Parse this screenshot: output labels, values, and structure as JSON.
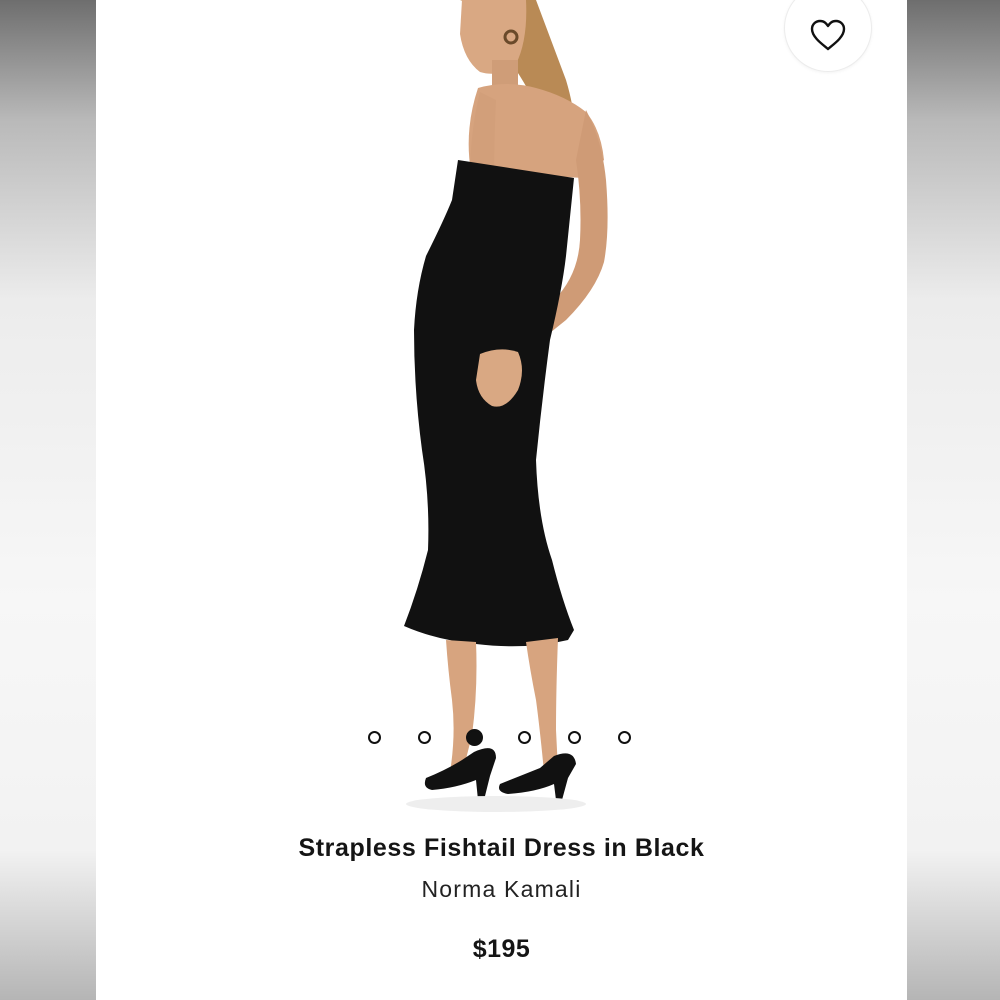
{
  "product": {
    "name": "Strapless Fishtail Dress in Black",
    "brand": "Norma Kamali",
    "price": "$195"
  },
  "favorite": {
    "icon": "heart-outline-icon"
  },
  "carousel": {
    "total": 6,
    "active_index": 2
  },
  "colors": {
    "text": "#151515",
    "dress": "#111111",
    "skin": "#d9a883",
    "hair": "#b98a55"
  }
}
